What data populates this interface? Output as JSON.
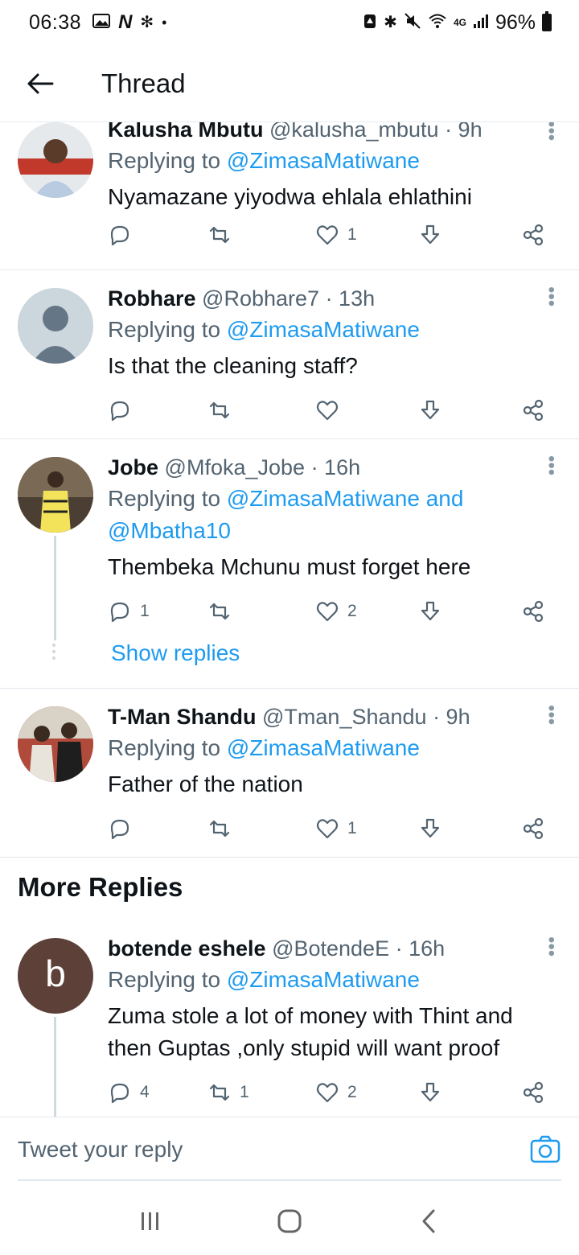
{
  "status_bar": {
    "time": "06:38",
    "battery": "96%",
    "network": "4G",
    "icons_left": [
      "gallery-icon",
      "n-app-icon",
      "fan-icon",
      "dot-icon"
    ],
    "icons_right": [
      "alarm-icon",
      "bluetooth-icon",
      "mute-icon",
      "wifi-icon",
      "signal-icon",
      "battery-icon"
    ]
  },
  "header": {
    "title": "Thread"
  },
  "tweets": [
    {
      "name": "Kalusha Mbutu",
      "handle": "@kalusha_mbutu",
      "time": "· 9h",
      "replying_prefix": "Replying to",
      "replying_to": "@ZimasaMatiwane",
      "text": "Nyamazane yiyodwa ehlala ehlathini",
      "replies": "",
      "retweets": "",
      "likes": "1"
    },
    {
      "name": "Robhare",
      "handle": "@Robhare7",
      "time": "· 13h",
      "replying_prefix": "Replying to",
      "replying_to": "@ZimasaMatiwane",
      "text": "Is that the cleaning staff?",
      "replies": "",
      "retweets": "",
      "likes": ""
    },
    {
      "name": "Jobe",
      "handle": "@Mfoka_Jobe",
      "time": "· 16h",
      "replying_prefix": "Replying to",
      "replying_to": "@ZimasaMatiwane",
      "replying_and": "and",
      "replying_to_2": "@Mbatha10",
      "text": "Thembeka Mchunu must forget here",
      "replies": "1",
      "retweets": "",
      "likes": "2",
      "show_replies": "Show replies"
    },
    {
      "name": "T-Man Shandu",
      "handle": "@Tman_Shandu",
      "time": "· 9h",
      "replying_prefix": "Replying to",
      "replying_to": "@ZimasaMatiwane",
      "text": "Father of the nation",
      "replies": "",
      "retweets": "",
      "likes": "1"
    }
  ],
  "more_replies": {
    "title": "More Replies",
    "tweet": {
      "avatar_letter": "b",
      "name": "botende eshele",
      "handle": "@BotendeE",
      "time": "· 16h",
      "replying_prefix": "Replying to",
      "replying_to": "@ZimasaMatiwane",
      "text_line1": "Zuma stole a lot of money with Thint and",
      "text_line2": "then Guptas ,only stupid will want proof",
      "replies": "4",
      "retweets": "1",
      "likes": "2"
    }
  },
  "reply_bar": {
    "placeholder": "Tweet your reply"
  },
  "colors": {
    "accent": "#1d9bf0",
    "text_primary": "#0f1419",
    "text_secondary": "#536471",
    "divider": "#e1e8ed",
    "avatar_b_bg": "#5d4037"
  }
}
